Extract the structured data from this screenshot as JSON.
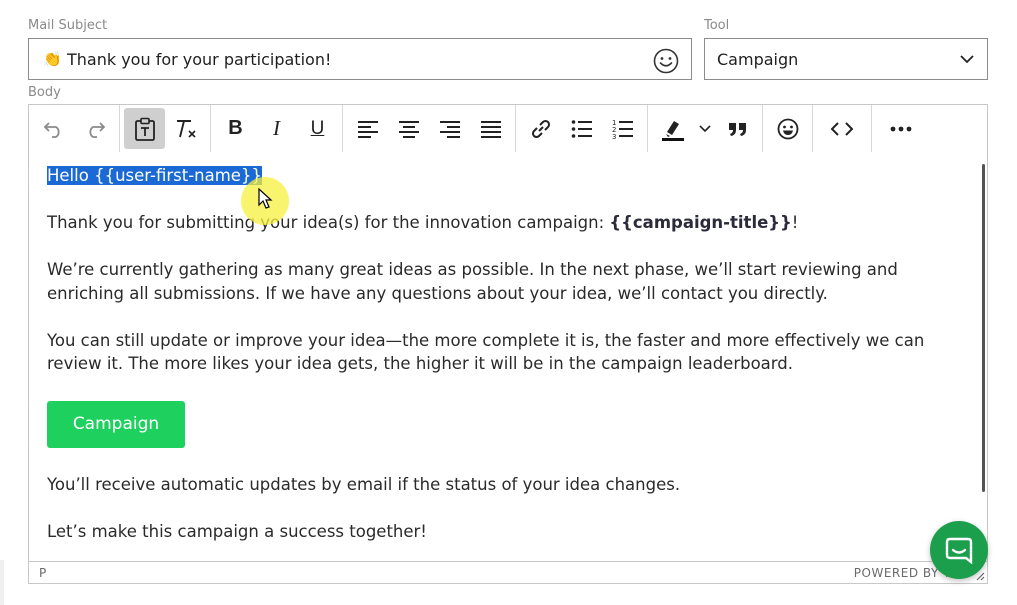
{
  "form": {
    "subject_label": "Mail Subject",
    "subject_emoji": "👏",
    "subject_value": "Thank you for your participation!",
    "tool_label": "Tool",
    "tool_value": "Campaign",
    "body_label": "Body"
  },
  "toolbar": {
    "buttons": [
      "undo",
      "redo",
      "paste-as-text",
      "clear-formatting",
      "bold",
      "italic",
      "underline",
      "align-left",
      "align-center",
      "align-right",
      "justify",
      "link",
      "bullet-list",
      "numbered-list",
      "highlight-color",
      "highlight-dropdown",
      "blockquote",
      "emoticons",
      "source-code",
      "more"
    ],
    "active": "paste-as-text",
    "bold_label": "B",
    "italic_label": "I",
    "underline_label": "U",
    "clear_format_label": "T",
    "quote_label": "❞"
  },
  "body": {
    "greeting": "Hello {{user-first-name}}",
    "line1_pre": "Thank you for submitting your idea(s) for the innovation campaign: ",
    "line1_bold": "{{campaign-title}}",
    "line1_post": "!",
    "para2": "We’re currently gathering as many great ideas as possible. In the next phase, we’ll start reviewing and enriching all submissions. If we have any questions about your idea, we’ll contact you directly.",
    "para3": "You can still update or improve your idea—the more complete it is, the faster and more effectively we can review it. The more likes your idea gets, the higher it will be in the campaign leaderboard.",
    "button_label": "Campaign",
    "para4": "You’ll receive automatic updates by email if the status of your idea changes.",
    "para5": "Let’s make this campaign a success together!"
  },
  "status": {
    "element_path": "P",
    "powered_by": "POWERED BY TI"
  },
  "colors": {
    "selection": "#1a69d4",
    "campaign_button": "#1ed15f",
    "chat_bubble": "#1c9f4c"
  }
}
